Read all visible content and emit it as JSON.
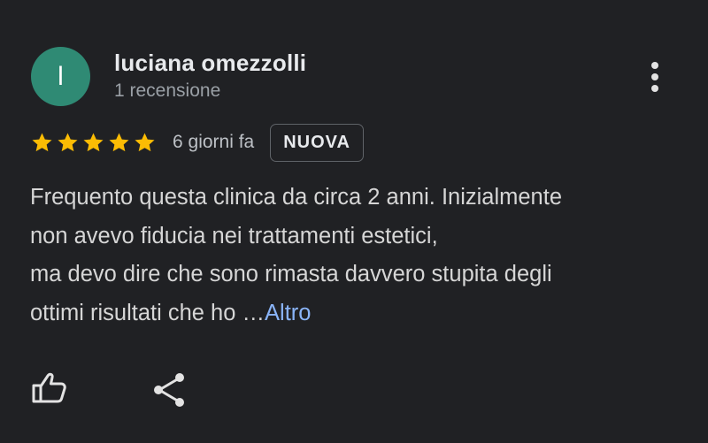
{
  "author": {
    "initial": "l",
    "name": "luciana omezzolli",
    "review_count": "1 recensione",
    "avatar_color": "#2f8a74"
  },
  "rating": {
    "stars": 5,
    "star_color": "#fbbc04",
    "date": "6 giorni fa",
    "badge": "NUOVA"
  },
  "review": {
    "lines": [
      "Frequento questa clinica da circa 2 anni. Inizialmente",
      "non avevo fiducia nei trattamenti estetici,",
      "ma devo dire che sono rimasta davvero stupita degli",
      "ottimi risultati che ho …"
    ],
    "more_label": "Altro"
  },
  "icons": {
    "menu": "more-vert-icon",
    "like": "thumb-up-icon",
    "share": "share-icon"
  }
}
